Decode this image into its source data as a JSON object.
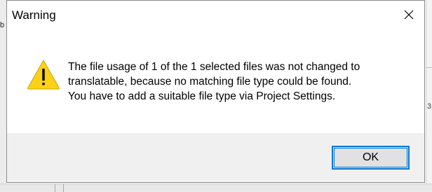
{
  "dialog": {
    "title": "Warning",
    "close_icon": "close-icon",
    "warning_icon": "warning-triangle-icon",
    "message_lines": [
      "The file usage of 1 of the 1 selected files was not changed to",
      "translatable, because no matching file type could be found.",
      "You have to add a suitable file type via Project Settings."
    ],
    "ok_label": "OK"
  },
  "background": {
    "left_mark": "b",
    "right_mark": "3"
  },
  "colors": {
    "accent": "#0078d7",
    "footer_bg": "#f0f0f0",
    "warning_yellow": "#fcd116"
  }
}
